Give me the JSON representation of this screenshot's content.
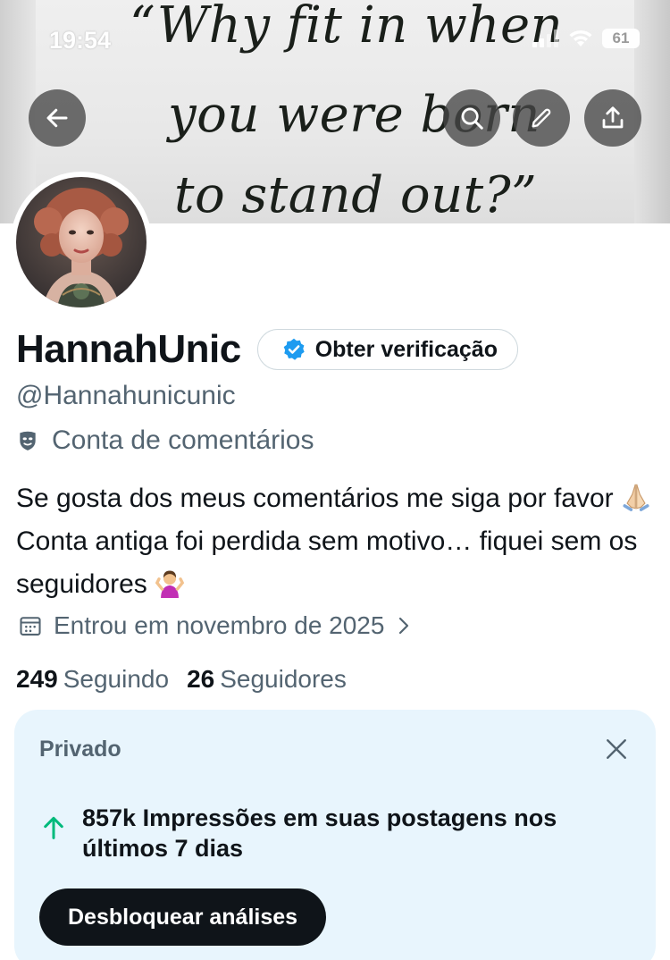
{
  "status_bar": {
    "time": "19:54",
    "battery": "61"
  },
  "header": {
    "quote_line1": "“Why fit in when",
    "quote_line2": "you were born",
    "quote_line3": "to stand out?”"
  },
  "profile": {
    "display_name": "HannahUnic",
    "verify_label": "Obter verificação",
    "handle": "@Hannahunicunic",
    "category": "Conta de comentários",
    "bio_part1": "Se gosta dos meus comentários me siga por favor",
    "bio_part2": "Conta antiga foi perdida sem motivo… fiquei sem os seguidores",
    "joined": "Entrou em novembro de 2025",
    "following_count": "249",
    "following_label": "Seguindo",
    "followers_count": "26",
    "followers_label": "Seguidores"
  },
  "private_card": {
    "title": "Privado",
    "stat_text": "857k Impressões em suas postagens nos últimos 7 dias",
    "button_label": "Desbloquear análises"
  },
  "colors": {
    "accent_blue": "#1d9bf0",
    "card_bg": "#e8f5fd",
    "stat_green": "#00ba7c",
    "secondary_text": "#536471"
  }
}
